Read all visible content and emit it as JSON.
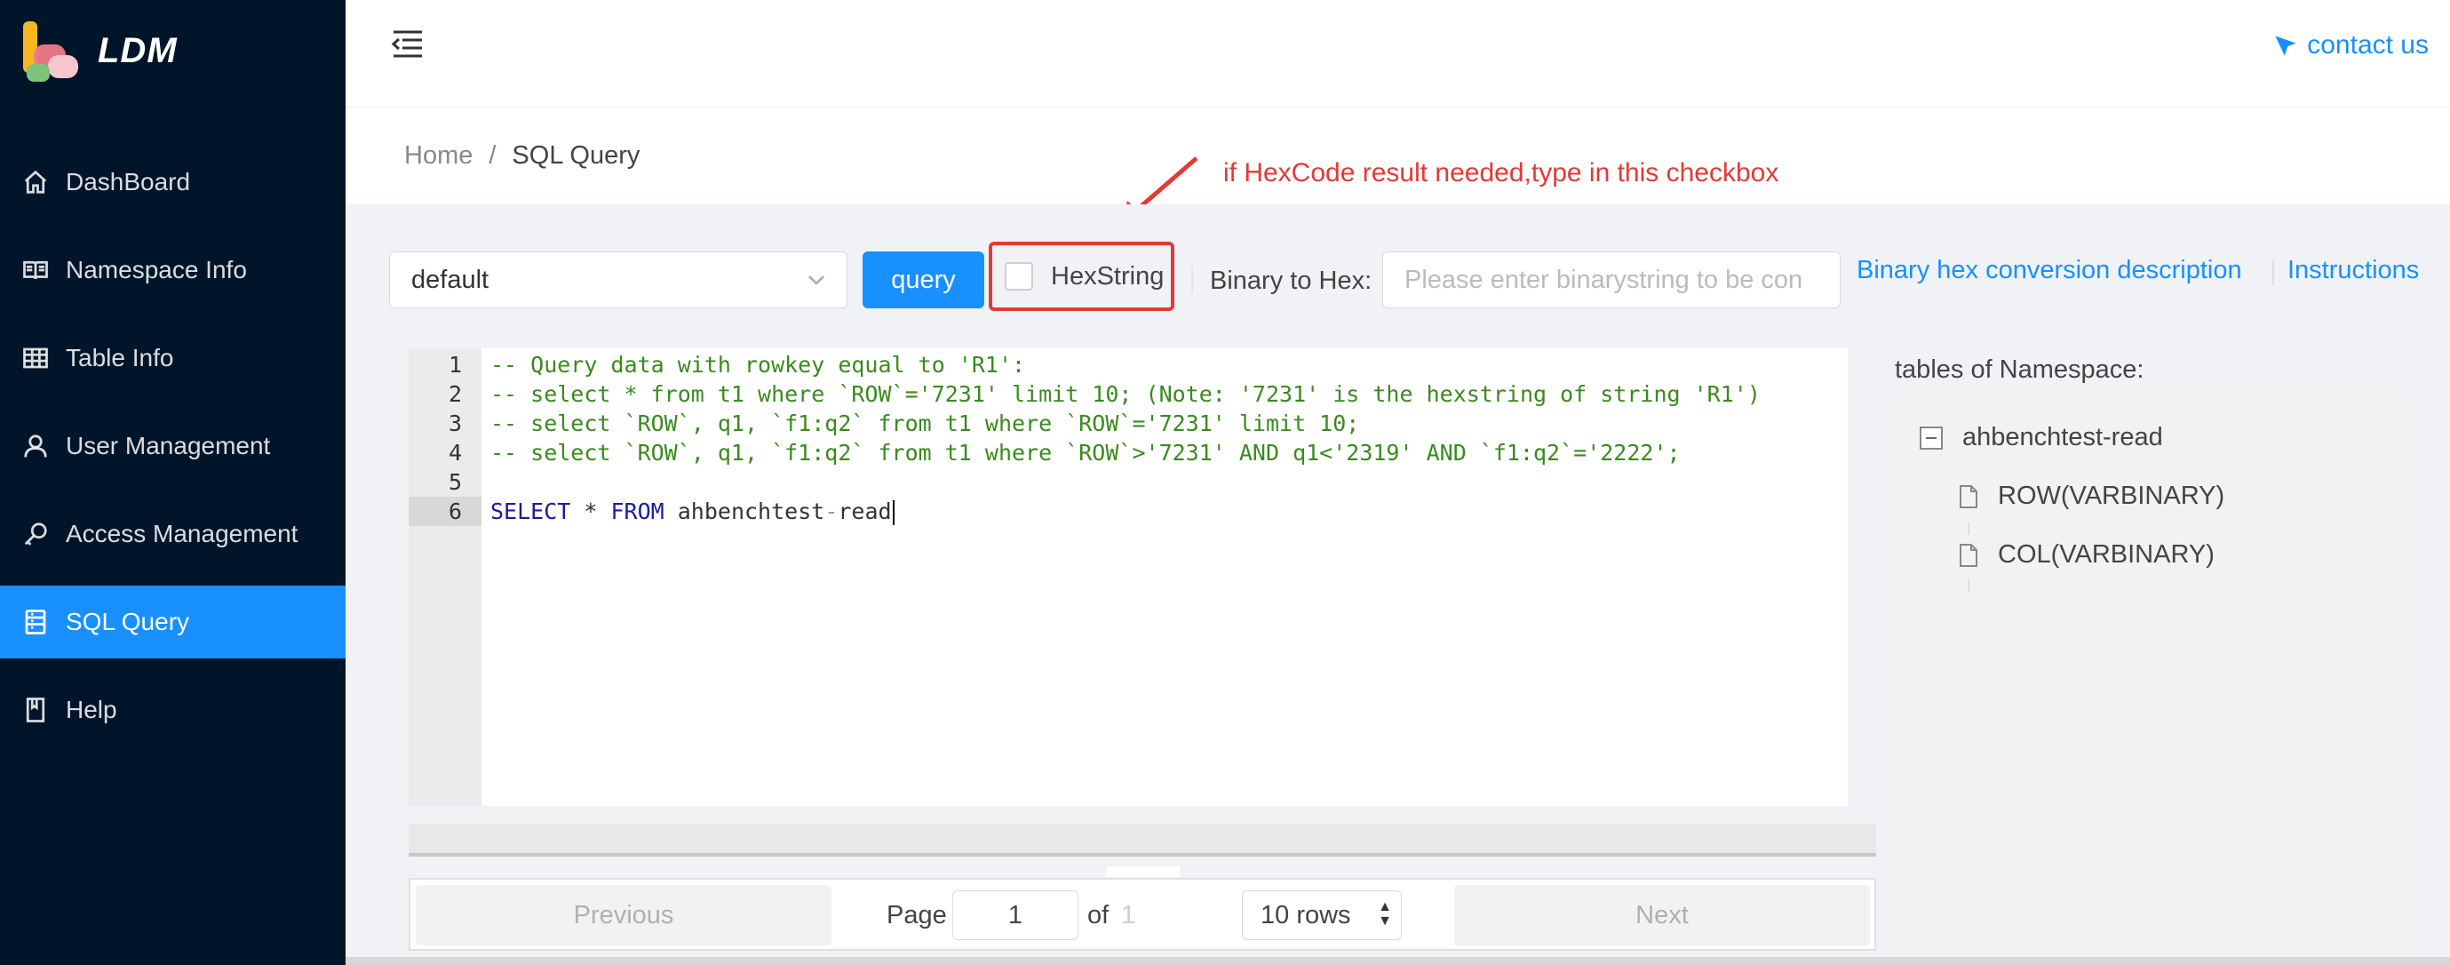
{
  "app": {
    "logo_text": "LDM"
  },
  "sidebar": {
    "items": [
      {
        "label": "DashBoard",
        "icon": "home-icon"
      },
      {
        "label": "Namespace Info",
        "icon": "book-icon"
      },
      {
        "label": "Table Info",
        "icon": "table-icon"
      },
      {
        "label": "User Management",
        "icon": "user-icon"
      },
      {
        "label": "Access Management",
        "icon": "key-icon"
      },
      {
        "label": "SQL Query",
        "icon": "database-icon",
        "active": true
      },
      {
        "label": "Help",
        "icon": "help-book-icon"
      }
    ]
  },
  "header": {
    "contact_label": "contact us"
  },
  "breadcrumb": {
    "home": "Home",
    "separator": "/",
    "current": "SQL Query"
  },
  "annotation": {
    "text": "if HexCode result needed,type in this checkbox",
    "color": "#e53935"
  },
  "toolbar": {
    "namespace_value": "default",
    "query_label": "query",
    "hexstring_label": "HexString",
    "hexstring_checked": false,
    "binary_label": "Binary to Hex:",
    "binary_placeholder": "Please enter binarystring to be con",
    "conversion_link": "Binary hex conversion description",
    "instructions_link": "Instructions"
  },
  "editor": {
    "lines": [
      {
        "num": "1",
        "text": "-- Query data with rowkey equal to 'R1':"
      },
      {
        "num": "2",
        "text": "-- select * from t1 where `ROW`='7231' limit 10; (Note: '7231' is the hexstring of string 'R1')"
      },
      {
        "num": "3",
        "text": "-- select `ROW`, q1, `f1:q2` from t1 where `ROW`='7231' limit 10;"
      },
      {
        "num": "4",
        "text": "-- select `ROW`, q1, `f1:q2` from t1 where `ROW`>'7231' AND q1<'2319' AND `f1:q2`='2222';"
      },
      {
        "num": "5",
        "text": ""
      },
      {
        "num": "6",
        "kw1": "SELECT",
        "mid": " * ",
        "kw2": "FROM",
        "rest": " ahbenchtest",
        "dash": "-",
        "rest2": "read"
      }
    ]
  },
  "pager": {
    "prev_label": "Previous",
    "next_label": "Next",
    "page_label": "Page",
    "page_value": "1",
    "of_label": "of",
    "total_pages": "1",
    "rows_value": "10 rows"
  },
  "tables_panel": {
    "title": "tables of Namespace:",
    "table_name": "ahbenchtest-read",
    "columns": [
      "ROW(VARBINARY)",
      "COL(VARBINARY)"
    ]
  },
  "colors": {
    "accent": "#1890ff",
    "sidebar_bg": "#001529",
    "annotation_red": "#e53935"
  }
}
